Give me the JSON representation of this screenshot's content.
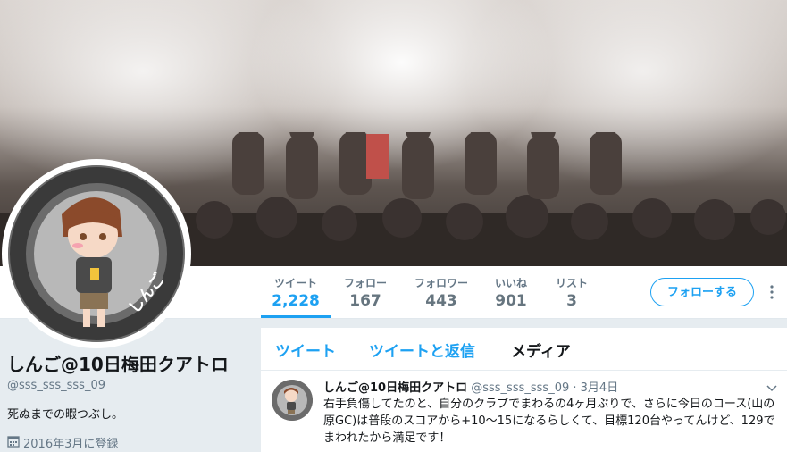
{
  "stats": [
    {
      "label": "ツイート",
      "value": "2,228",
      "active": true
    },
    {
      "label": "フォロー",
      "value": "167",
      "active": false
    },
    {
      "label": "フォロワー",
      "value": "443",
      "active": false
    },
    {
      "label": "いいね",
      "value": "901",
      "active": false
    },
    {
      "label": "リスト",
      "value": "3",
      "active": false
    }
  ],
  "follow_button": "フォローする",
  "more_icon": "more-vertical-icon",
  "avatar_text": "しんご",
  "profile": {
    "name": "しんご@10日梅田クアトロ",
    "handle": "@sss_sss_sss_09",
    "bio": "死ぬまでの暇つぶし。",
    "joined": "2016年3月に登録",
    "joined_icon": "calendar-icon"
  },
  "tabs": [
    {
      "label": "ツイート",
      "active": true
    },
    {
      "label": "ツイートと返信",
      "active": true
    },
    {
      "label": "メディア",
      "active": false
    }
  ],
  "tweet": {
    "name": "しんご@10日梅田クアトロ",
    "handle": "@sss_sss_sss_09",
    "separator": "·",
    "date": "3月4日",
    "text": "右手負傷してたのと、自分のクラブでまわるの4ヶ月ぶりで、さらに今日のコース(山の原GC)は普段のスコアから+10〜15になるらしくて、目標120台やってんけど、129でまわれたから満足です！"
  },
  "colors": {
    "accent": "#1da1f2",
    "muted": "#657786",
    "background": "#e6ecf0"
  }
}
